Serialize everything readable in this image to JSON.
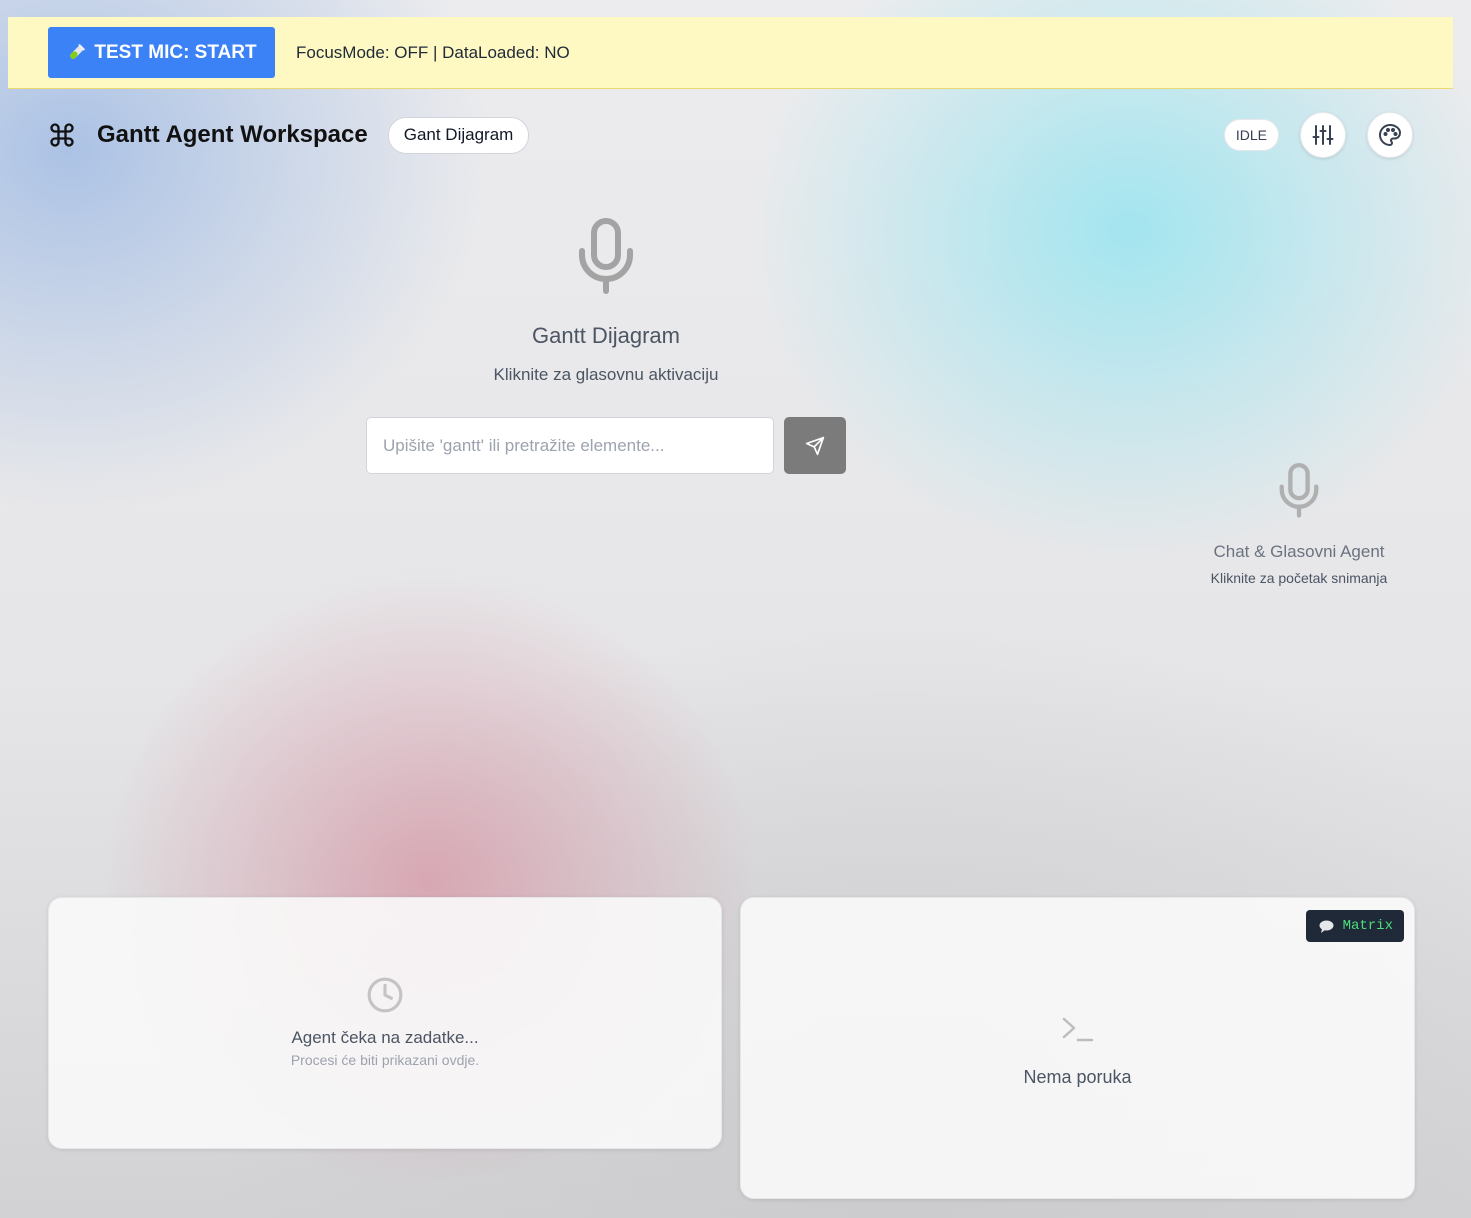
{
  "debug_bar": {
    "test_mic_label": "TEST MIC: START",
    "test_mic_icon": "test-tube-icon",
    "status_text": "FocusMode: OFF | DataLoaded: NO",
    "background_color": "#fef9c3",
    "button_color": "#3b82f6"
  },
  "header": {
    "logo_icon": "command-icon",
    "title": "Gantt Agent Workspace",
    "mode_pill": "Gant Dijagram",
    "status_badge": "IDLE",
    "settings_icon": "sliders-icon",
    "theme_icon": "palette-icon"
  },
  "voice_center": {
    "icon": "microphone-icon",
    "title": "Gantt Dijagram",
    "subtitle": "Kliknite za glasovnu aktivaciju",
    "search_placeholder": "Upišite 'gantt' ili pretražite elemente...",
    "search_value": "",
    "send_icon": "send-icon"
  },
  "voice_agent": {
    "icon": "microphone-icon",
    "title": "Chat & Glasovni Agent",
    "subtitle": "Kliknite za početak snimanja"
  },
  "tasks_panel": {
    "icon": "clock-icon",
    "empty_title": "Agent čeka na zadatke...",
    "empty_subtitle": "Procesi će biti prikazani ovdje."
  },
  "messages_panel": {
    "badge_icon": "speech-bubble-icon",
    "badge_label": "Matrix",
    "badge_color": "#4ade80",
    "empty_icon": "terminal-icon",
    "empty_title": "Nema poruka"
  }
}
